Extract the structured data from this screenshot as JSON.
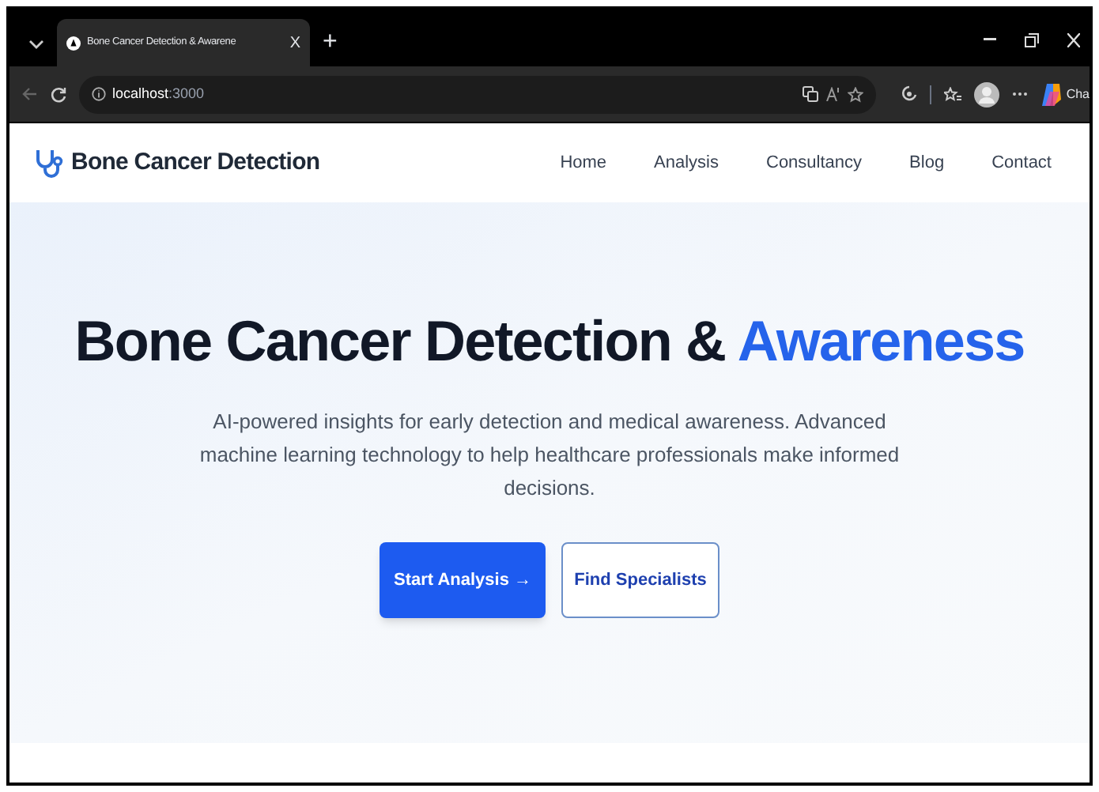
{
  "browser": {
    "tab_title": "Bone Cancer Detection & Awarene",
    "tab_close": "X",
    "new_tab": "+",
    "url_host": "localhost",
    "url_port": ":3000",
    "copilot_label": "Cha"
  },
  "navbar": {
    "brand": "Bone Cancer Detection",
    "links": [
      {
        "label": "Home"
      },
      {
        "label": "Analysis"
      },
      {
        "label": "Consultancy"
      },
      {
        "label": "Blog"
      },
      {
        "label": "Contact"
      }
    ]
  },
  "hero": {
    "heading": "Bone Cancer Detection & ",
    "heading_highlight": "Awareness",
    "subtitle": "AI-powered insights for early detection and medical awareness. Advanced machine learning technology to help healthcare professionals make informed decisions.",
    "buttons": [
      {
        "label": "Start Analysis →",
        "kind": "primary"
      },
      {
        "label": "Find Specialists",
        "kind": "secondary"
      }
    ]
  }
}
